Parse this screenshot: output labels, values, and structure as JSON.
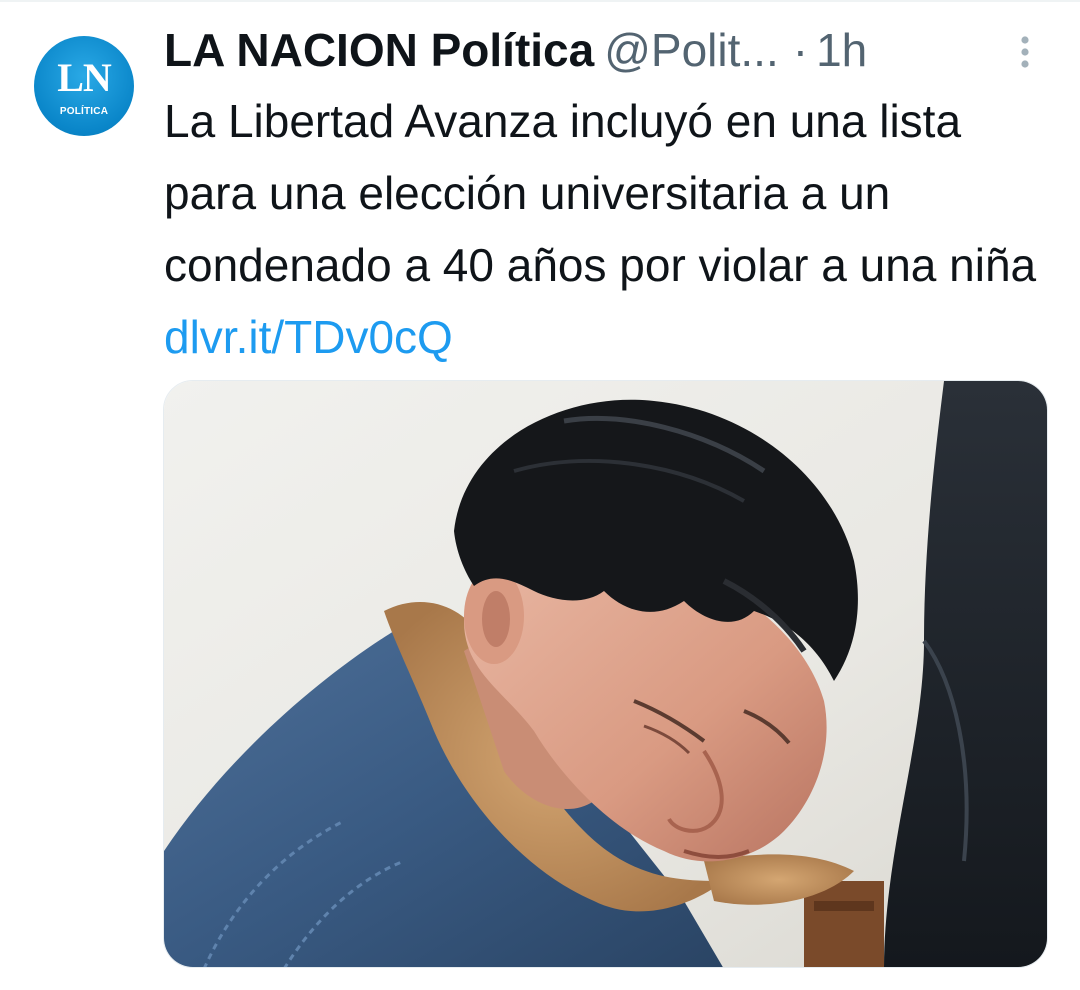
{
  "tweet": {
    "author": {
      "display_name": "LA NACION Política",
      "handle": "@Polit...",
      "avatar_text": "LN",
      "avatar_subtext": "POLÍTICA"
    },
    "separator": "·",
    "timestamp": "1h",
    "text": "La Libertad Avanza incluyó en una lista para una elección universitaria a un condenado a 40 años por violar a una niña",
    "link": "dlvr.it/TDv0cQ",
    "media": {
      "type": "photo",
      "subject": "man-in-denim-jacket-with-shearling-collar"
    }
  },
  "colors": {
    "text_primary": "#0f1419",
    "text_secondary": "#536471",
    "link": "#1d9bf0",
    "avatar_bg": "#0a86c9"
  },
  "icons": [
    "more-options-icon"
  ]
}
